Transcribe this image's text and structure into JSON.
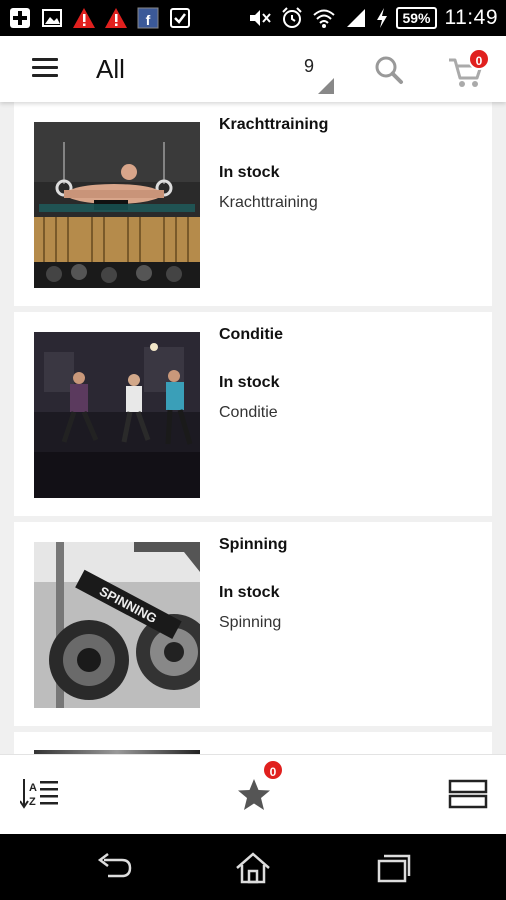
{
  "status_bar": {
    "left_icons": [
      "add-box-icon",
      "image-icon",
      "warning-icon",
      "warning-icon",
      "facebook-app-icon",
      "checkbox-icon"
    ],
    "right_icons": [
      "mute-icon",
      "alarm-icon",
      "wifi-icon",
      "signal-icon",
      "charging-icon"
    ],
    "battery": "59%",
    "time": "11:49"
  },
  "app_bar": {
    "title": "All",
    "sort_value": "9",
    "cart_count": "0"
  },
  "products": [
    {
      "title": "Krachttraining",
      "stock": "In stock",
      "category": "Krachttraining",
      "image": "gymnastics-rings-photo"
    },
    {
      "title": "Conditie",
      "stock": "In stock",
      "category": "Conditie",
      "image": "running-group-photo"
    },
    {
      "title": "Spinning",
      "stock": "In stock",
      "category": "Spinning",
      "image": "spinning-bikes-photo"
    }
  ],
  "bottom_bar": {
    "favorites_count": "0",
    "icons": [
      "sort-az-icon",
      "star-icon",
      "view-toggle-icon"
    ]
  },
  "nav_bar": {
    "icons": [
      "back-icon",
      "home-icon",
      "recent-apps-icon"
    ]
  },
  "colors": {
    "badge": "#e0201e",
    "background": "#f0f0f0"
  }
}
